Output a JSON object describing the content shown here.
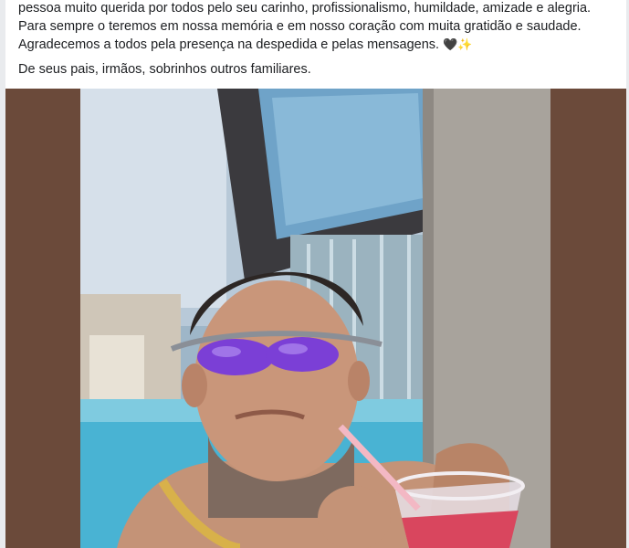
{
  "post": {
    "lines": [
      "pessoa muito querida por todos pelo seu carinho, profissionalismo, humildade, amizade e alegria.",
      "Para sempre o teremos em nossa memória e em nosso coração com muita gratidão e saudade.",
      "Agradecemos a todos pela presença na despedida e pelas mensagens.",
      "De seus pais, irmãos, sobrinhos outros familiares."
    ],
    "emoji": "🖤✨"
  },
  "photo": {
    "icon": "post-photo"
  },
  "colors": {
    "frame": "#6b4a3a",
    "pool": "#49b3d3",
    "lens": "#7b3fd6"
  }
}
